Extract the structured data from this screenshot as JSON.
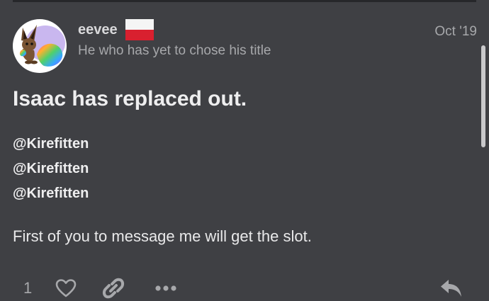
{
  "post": {
    "author": {
      "username": "eevee",
      "user_title": "He who has yet to chose his title",
      "flag": "poland-flag",
      "avatar": "eevee-avatar"
    },
    "date": "Oct '19",
    "heading": "Isaac has replaced out.",
    "mentions": [
      "@Kirefitten",
      "@Kirefitten",
      "@Kirefitten"
    ],
    "body": "First of you to message me will get the slot."
  },
  "actions": {
    "like_count": "1",
    "icons": [
      "heart-icon",
      "link-icon",
      "more-icon",
      "reply-icon"
    ]
  },
  "colors": {
    "background": "#3f4044",
    "text": "#e9e9ea",
    "muted": "#a7a8ab",
    "flag_red": "#d9202f"
  }
}
